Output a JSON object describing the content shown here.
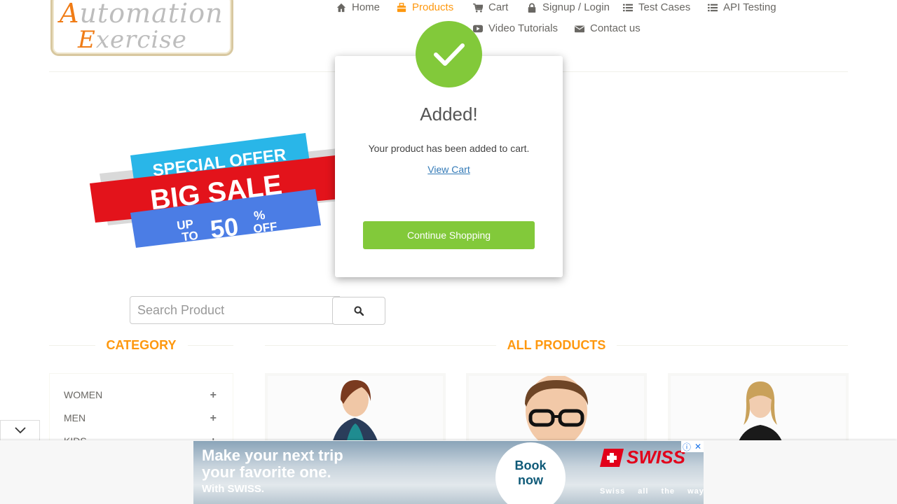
{
  "logo": {
    "line1_cap": "A",
    "line1_rest": "utomation",
    "line2_cap": "E",
    "line2_rest": "xercise"
  },
  "nav": {
    "home": "Home",
    "products": "Products",
    "cart": "Cart",
    "signup_login": "Signup / Login",
    "test_cases": "Test Cases",
    "api_testing": "API Testing",
    "video_tutorials": "Video Tutorials",
    "contact_us": "Contact us"
  },
  "banner": {
    "special_offer": "SPECIAL OFFER",
    "big_sale": "BIG SALE",
    "up": "UP",
    "to": "TO",
    "percent_value": "50",
    "percent_sign": "%",
    "off": "OFF"
  },
  "search": {
    "placeholder": "Search Product"
  },
  "sections": {
    "category_title": "CATEGORY",
    "products_title": "ALL PRODUCTS"
  },
  "categories": [
    {
      "label": "Women"
    },
    {
      "label": "Men"
    },
    {
      "label": "Kids"
    }
  ],
  "modal": {
    "title": "Added!",
    "message": "Your product has been added to cart.",
    "view_cart_link": "View Cart",
    "continue_button": "Continue Shopping"
  },
  "ad": {
    "line1": "Make your next trip",
    "line2": "your favorite one.",
    "line3": "With SWISS.",
    "cta_line1": "Book",
    "cta_line2": "now",
    "brand": "SWISS",
    "tagline": "Swiss all the way"
  },
  "colors": {
    "accent": "#fe980f",
    "success": "#82c93a",
    "link": "#337ab7",
    "brand_red": "#e2001a"
  }
}
